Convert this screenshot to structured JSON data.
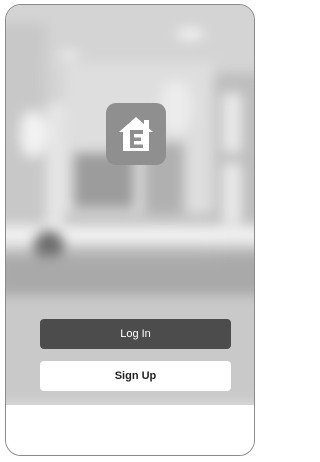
{
  "app": {
    "logo_icon": "house-e-icon",
    "accent_dark": "#4c4c4c"
  },
  "auth": {
    "login_label": "Log In",
    "signup_label": "Sign Up"
  }
}
